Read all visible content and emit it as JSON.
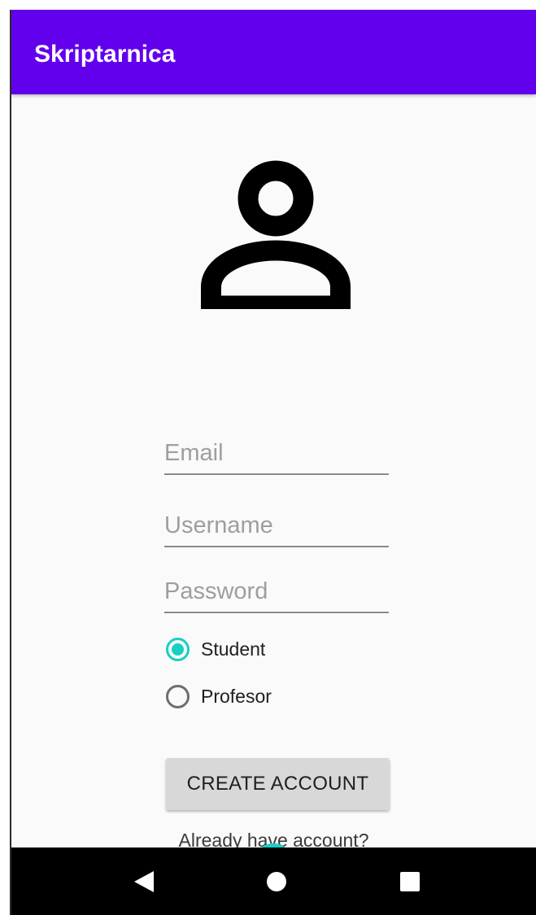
{
  "app_bar": {
    "title": "Skriptarnica",
    "color": "#6200ee"
  },
  "avatar": {
    "icon": "person-outline-icon"
  },
  "form": {
    "email": {
      "placeholder": "Email",
      "value": ""
    },
    "username": {
      "placeholder": "Username",
      "value": ""
    },
    "password": {
      "placeholder": "Password",
      "value": ""
    },
    "role_options": [
      {
        "label": "Student",
        "checked": true
      },
      {
        "label": "Profesor",
        "checked": false
      }
    ],
    "create_button_label": "CREATE ACCOUNT",
    "login_link_text": "Already have account?"
  },
  "colors": {
    "accent": "#18cfc4",
    "nav_bar": "#000000"
  },
  "nav": {
    "back_icon": "back-triangle-icon",
    "home_icon": "home-circle-icon",
    "recents_icon": "recents-square-icon"
  }
}
